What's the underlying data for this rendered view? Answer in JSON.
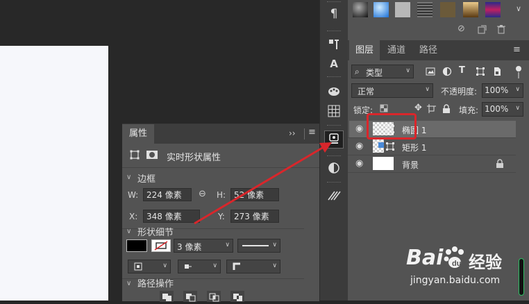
{
  "properties_panel": {
    "tab_label": "属性",
    "header_label": "实时形状属性",
    "bounds_section": "边框",
    "w_label": "W:",
    "w_value": "224 像素",
    "h_label": "H:",
    "h_value": "52 像素",
    "x_label": "X:",
    "x_value": "348 像素",
    "y_label": "Y:",
    "y_value": "273 像素",
    "shape_section": "形状细节",
    "stroke_width": "3 像素",
    "path_section": "路径操作"
  },
  "layers_panel": {
    "tabs": [
      "图层",
      "通道",
      "路径"
    ],
    "filter_label": "类型",
    "blend_mode": "正常",
    "opacity_label": "不透明度:",
    "opacity_value": "100%",
    "lock_label": "锁定:",
    "fill_label": "填充:",
    "fill_value": "100%",
    "layers": [
      {
        "name": "椭圆 1"
      },
      {
        "name": "矩形 1"
      },
      {
        "name": "背景"
      }
    ]
  },
  "watermark": {
    "brand_word": "Bai",
    "brand_suffix": "经验",
    "url": "jingyan.baidu.com"
  },
  "icons": {
    "paragraph": "¶",
    "type_a": "A",
    "eye": "◉",
    "text_t": "T"
  },
  "colors": {
    "highlight_box": "#d9262b",
    "annotation_arrow": "#d9262b",
    "panel_bg": "#535353"
  }
}
